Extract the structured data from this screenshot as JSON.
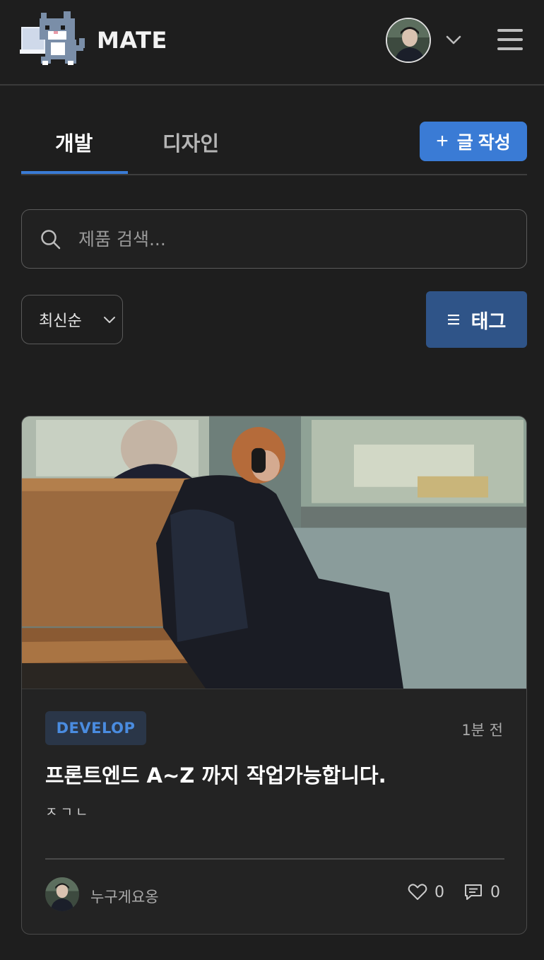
{
  "header": {
    "brand": "MATE",
    "logo_icon": "pixel-cat-laptop-logo",
    "avatar_icon": "user-avatar",
    "chevron_icon": "chevron-down-icon",
    "menu_icon": "hamburger-menu-icon"
  },
  "tabs": [
    {
      "label": "개발",
      "active": true
    },
    {
      "label": "디자인",
      "active": false
    }
  ],
  "write_button": {
    "icon": "plus-icon",
    "label": "글 작성"
  },
  "search": {
    "placeholder": "제품 검색..."
  },
  "sort": {
    "selected": "최신순"
  },
  "tag_button": {
    "icon": "list-icon",
    "label": "태그"
  },
  "post": {
    "category": "DEVELOP",
    "time": "1분 전",
    "title": "프론트엔드 A~Z 까지 작업가능합니다.",
    "excerpt": "ㅈㄱㄴ",
    "author": "누구게요옹",
    "likes": "0",
    "comments": "0"
  },
  "colors": {
    "background": "#1e1e1e",
    "accent": "#3a7bd5",
    "tag_button": "#2f5488",
    "badge_bg": "#2a3648",
    "badge_text": "#4a8ce0"
  }
}
